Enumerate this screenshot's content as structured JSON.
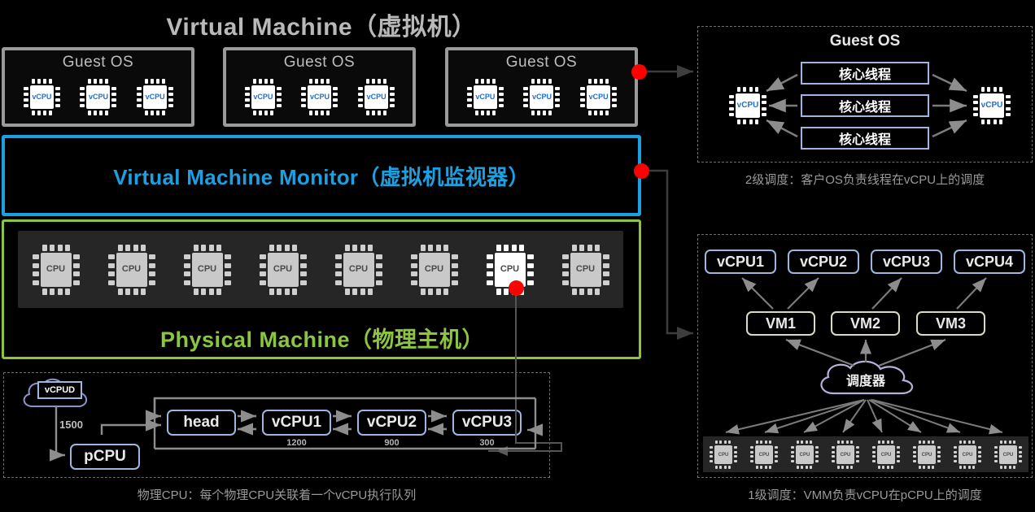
{
  "left": {
    "vm_title": "Virtual Machine（虚拟机）",
    "vmm_title": "Virtual Machine Monitor（虚拟机监视器）",
    "pm_title": "Physical Machine（物理主机）",
    "guest_os_label": "Guest OS",
    "guests": [
      {
        "label": "Guest OS",
        "vcpus": [
          "vCPU",
          "vCPU",
          "vCPU"
        ]
      },
      {
        "label": "Guest OS",
        "vcpus": [
          "vCPU",
          "vCPU",
          "vCPU"
        ]
      },
      {
        "label": "Guest OS",
        "vcpus": [
          "vCPU",
          "vCPU",
          "vCPU"
        ]
      }
    ],
    "physical_cpus": [
      "CPU",
      "CPU",
      "CPU",
      "CPU",
      "CPU",
      "CPU",
      "CPU",
      "CPU"
    ],
    "highlighted_cpu_index": 6
  },
  "queue_panel": {
    "cloud_label": "vCPUD",
    "weight_label": "1500",
    "pcpu_label": "pCPU",
    "queue": [
      {
        "label": "head",
        "weight": ""
      },
      {
        "label": "vCPU1",
        "weight": "1200"
      },
      {
        "label": "vCPU2",
        "weight": "900"
      },
      {
        "label": "vCPU3",
        "weight": "300"
      }
    ],
    "caption": "物理CPU：每个物理CPU关联着一个vCPU执行队列"
  },
  "guest_sched_panel": {
    "title": "Guest OS",
    "threads": [
      "核心线程",
      "核心线程",
      "核心线程"
    ],
    "vcpu_left": "vCPU",
    "vcpu_right": "vCPU",
    "caption": "2级调度：客户OS负责线程在vCPU上的调度"
  },
  "vmm_sched_panel": {
    "vcpus": [
      "vCPU1",
      "vCPU2",
      "vCPU3",
      "vCPU4"
    ],
    "vms": [
      "VM1",
      "VM2",
      "VM3"
    ],
    "scheduler_label": "调度器",
    "pcpus": [
      "CPU",
      "CPU",
      "CPU",
      "CPU",
      "CPU",
      "CPU",
      "CPU",
      "CPU"
    ],
    "caption": "1级调度：VMM负责vCPU在pCPU上的调度"
  },
  "colors": {
    "background": "#000000",
    "vmm_accent": "#1BA1E2",
    "physical_accent": "#8CC63F",
    "guest_border": "#9a9a9a",
    "marker": "#FF0000",
    "vcpu_text": "#1F6FD0",
    "box_blue": "#9DB7E0",
    "box_olive": "#D8DCC0",
    "cloud_outline": "#B9AFD8",
    "caption_gray": "#9a9a9a"
  }
}
